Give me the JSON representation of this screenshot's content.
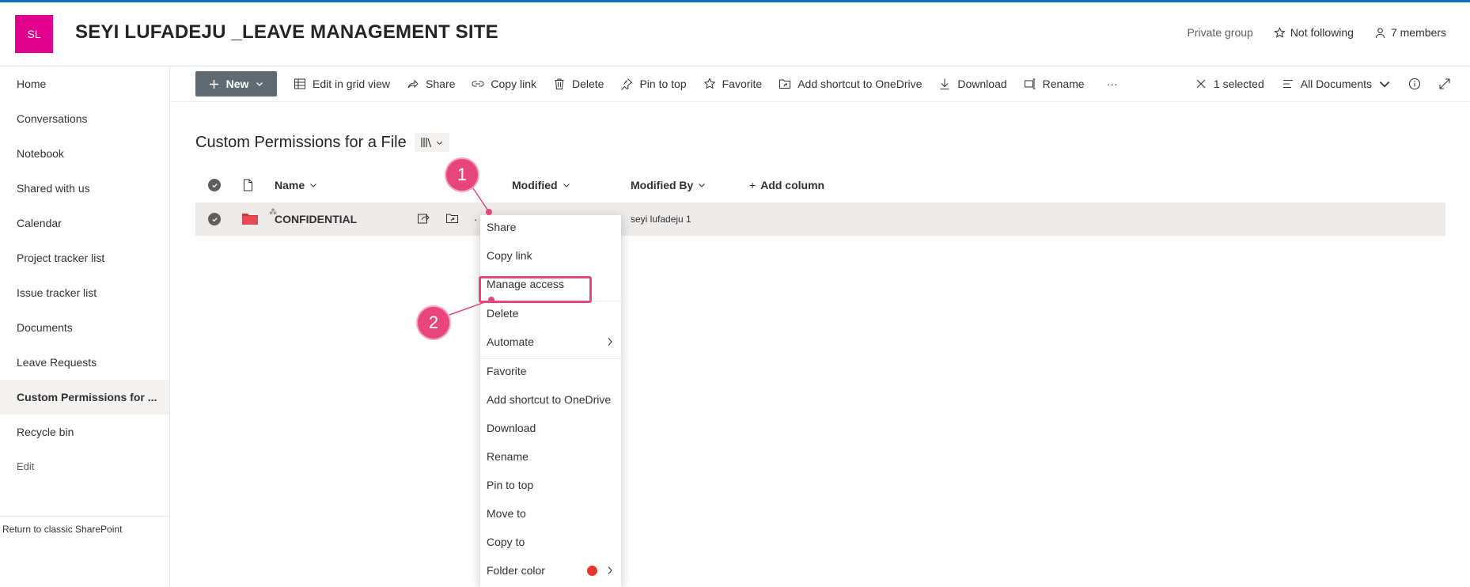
{
  "site": {
    "logo_initials": "SL",
    "title": "SEYI LUFADEJU _LEAVE MANAGEMENT SITE",
    "privacy": "Private group",
    "follow": "Not following",
    "members": "7 members"
  },
  "nav": {
    "items": [
      {
        "label": "Home"
      },
      {
        "label": "Conversations"
      },
      {
        "label": "Notebook"
      },
      {
        "label": "Shared with us"
      },
      {
        "label": "Calendar"
      },
      {
        "label": "Project tracker list"
      },
      {
        "label": "Issue tracker list"
      },
      {
        "label": "Documents"
      },
      {
        "label": "Leave Requests"
      },
      {
        "label": "Custom Permissions for ..."
      },
      {
        "label": "Recycle bin"
      }
    ],
    "edit": "Edit",
    "classic": "Return to classic SharePoint"
  },
  "commands": {
    "new": "New",
    "edit_grid": "Edit in grid view",
    "share": "Share",
    "copy_link": "Copy link",
    "delete": "Delete",
    "pin": "Pin to top",
    "favorite": "Favorite",
    "shortcut": "Add shortcut to OneDrive",
    "download": "Download",
    "rename": "Rename",
    "more": "···",
    "selected": "1 selected",
    "view": "All Documents"
  },
  "library": {
    "title": "Custom Permissions for a File"
  },
  "columns": {
    "name": "Name",
    "modified": "Modified",
    "modified_by": "Modified By",
    "add_column": "Add column"
  },
  "row": {
    "name": "CONFIDENTIAL",
    "modified_by": "seyi lufadeju 1"
  },
  "menu": {
    "share": "Share",
    "copy_link": "Copy link",
    "manage_access": "Manage access",
    "delete": "Delete",
    "automate": "Automate",
    "favorite": "Favorite",
    "shortcut": "Add shortcut to OneDrive",
    "download": "Download",
    "rename": "Rename",
    "pin": "Pin to top",
    "move": "Move to",
    "copy": "Copy to",
    "folder_color": "Folder color"
  },
  "callouts": {
    "one": "1",
    "two": "2"
  },
  "colors": {
    "logo": "#e3008c",
    "callout": "#e7467c",
    "folder": "#d13438",
    "folder_color_dot": "#e8372c"
  }
}
